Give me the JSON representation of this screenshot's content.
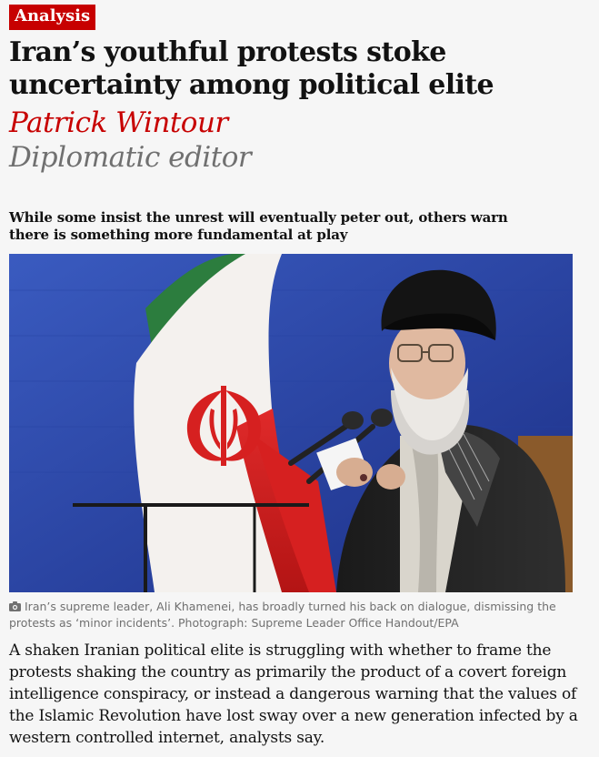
{
  "article": {
    "badge": "Analysis",
    "headline": "Iran’s youthful protests stoke uncertainty among political elite",
    "byline_name": "Patrick Wintour",
    "byline_role": "Diplomatic editor",
    "standfirst": "While some insist the unrest will eventually peter out, others warn there is something more fundamental at play",
    "photo": {
      "caption": "Iran’s supreme leader, Ali Khamenei, has broadly turned his back on dialogue, dismissing the protests as ‘minor incidents’. Photograph: Supreme Leader Office Handout/EPA",
      "caption_icon": "camera-icon"
    },
    "body": "A shaken Iranian political elite is struggling with whether to frame the protests shaking the country as primarily the product of a covert foreign intelligence conspiracy, or instead a dangerous warning that the values of the Islamic Revolution have lost sway over a new generation infected by a western controlled internet, analysts say."
  },
  "colors": {
    "accent": "#c70000",
    "secondary_text": "#707070",
    "background": "#f6f6f6"
  }
}
